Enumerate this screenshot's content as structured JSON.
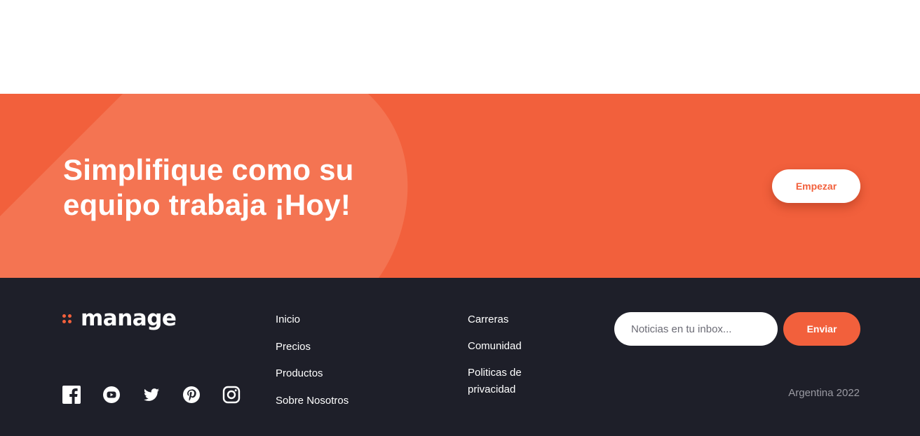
{
  "colors": {
    "accent": "#f2603c",
    "accent_light": "#f47452",
    "footer_bg": "#1e1f29",
    "white": "#ffffff",
    "muted": "#9a9aa2"
  },
  "cta": {
    "title": "Simplifique como su equipo trabaja ¡Hoy!",
    "button_label": "Empezar"
  },
  "footer": {
    "logo_text": "manage",
    "socials": [
      {
        "icon": "facebook-icon"
      },
      {
        "icon": "youtube-icon"
      },
      {
        "icon": "twitter-icon"
      },
      {
        "icon": "pinterest-icon"
      },
      {
        "icon": "instagram-icon"
      }
    ],
    "nav_col1": [
      "Inicio",
      "Precios",
      "Productos",
      "Sobre Nosotros"
    ],
    "nav_col2": [
      "Carreras",
      "Comunidad",
      "Politicas de privacidad"
    ],
    "newsletter": {
      "placeholder": "Noticias en tu inbox...",
      "button_label": "Enviar"
    },
    "copyright": "Argentina 2022"
  }
}
